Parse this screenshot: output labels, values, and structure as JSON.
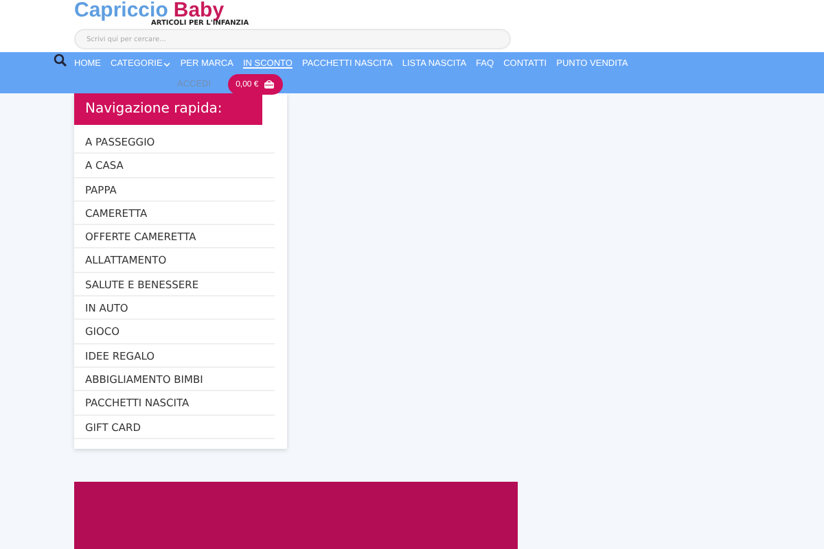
{
  "logo": {
    "part_1": "Capriccio",
    "part_2": "Baby",
    "tagline": "ARTICOLI PER L'INFANZIA"
  },
  "search": {
    "placeholder": "Scrivi qui per cercare..."
  },
  "nav": [
    {
      "label": "HOME",
      "dropdown": false,
      "selected": false
    },
    {
      "label": "CATEGORIE",
      "dropdown": true,
      "selected": false
    },
    {
      "label": "PER MARCA",
      "dropdown": false,
      "selected": false
    },
    {
      "label": "IN SCONTO",
      "dropdown": false,
      "selected": true
    },
    {
      "label": "PACCHETTI NASCITA",
      "dropdown": false,
      "selected": false
    },
    {
      "label": "LISTA NASCITA",
      "dropdown": false,
      "selected": false
    },
    {
      "label": "FAQ",
      "dropdown": false,
      "selected": false
    },
    {
      "label": "CONTATTI",
      "dropdown": false,
      "selected": false
    },
    {
      "label": "PUNTO VENDITA",
      "dropdown": false,
      "selected": false
    }
  ],
  "account": {
    "login": "ACCEDI"
  },
  "cart": {
    "total": "0,00 €"
  },
  "quick_nav": {
    "title": "Navigazione rapida:",
    "items": [
      "A PASSEGGIO",
      "A CASA",
      "PAPPA",
      "CAMERETTA",
      "OFFERTE CAMERETTA",
      "ALLATTAMENTO",
      "SALUTE E BENESSERE",
      "IN AUTO",
      "GIOCO",
      "IDEE REGALO",
      "ABBIGLIAMENTO BIMBI",
      "PACCHETTI NASCITA",
      "GIFT CARD"
    ]
  }
}
